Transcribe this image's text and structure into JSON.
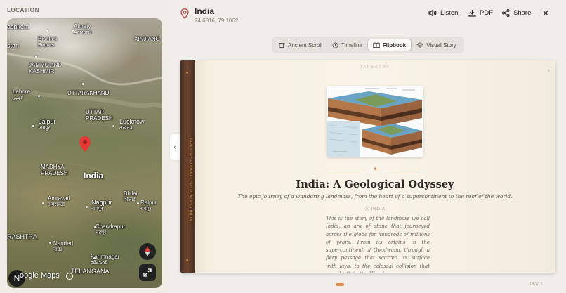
{
  "sidebar": {
    "location_label": "LOCATION",
    "map": {
      "labels": {
        "tashkent_l1": "ashkent",
        "almaty": "Almaty",
        "almaty_local": "Алматы",
        "bishkek": "Bishkek",
        "bishkek_local": "Бишкек",
        "xinjiang": "XINJIANG",
        "stan": "stan",
        "jammu": "JAMMU AND",
        "kashmir": "KASHMIR",
        "lahore": "Lahore",
        "lahore_local": "لاہور",
        "uttarakhand": "UTTARAKHAND",
        "uttar": "UTTAR",
        "pradesh": "PRADESH",
        "jaipur": "Jaipur",
        "jaipur_local": "जयपुर",
        "lucknow": "Lucknow",
        "lucknow_local": "लखनऊ",
        "madhya": "MADHYA",
        "madhya_pradesh": "PRADESH",
        "india": "India",
        "bhilai": "Bhilai",
        "bhilai_local": "भिलाई",
        "raipur": "Raipur",
        "raipur_local": "रायपुर",
        "amravati": "Amravati",
        "amravati_local": "अमरावती",
        "nagpur": "Nagpur",
        "nagpur_local": "नागपूर",
        "maharashtra": "RASHTRA",
        "chandrapur": "Chandrapur",
        "chandrapur_local": "चंद्रपूर",
        "nanded": "Nanded",
        "nanded_local": "नांदेड",
        "karimnagar": "Karimnagar",
        "karimnagar_local": "కరీంనగర్",
        "telangana": "TELANGANA",
        "google_maps": "oogle Maps"
      },
      "n_badge": "N",
      "compass_icon": "compass-icon",
      "expand_icon": "expand-icon"
    },
    "collapse_glyph": "‹"
  },
  "header": {
    "title": "India",
    "coords": "24.6816, 79.1062",
    "listen_label": "Listen",
    "pdf_label": "PDF",
    "share_label": "Share",
    "close_glyph": "✕"
  },
  "tabs": [
    {
      "label": "Ancient Scroll",
      "icon": "scroll-icon",
      "active": false
    },
    {
      "label": "Timeline",
      "icon": "clock-icon",
      "active": false
    },
    {
      "label": "Flipbook",
      "icon": "book-icon",
      "active": true
    },
    {
      "label": "Visual Story",
      "icon": "layers-icon",
      "active": false
    }
  ],
  "book": {
    "spine_text": "TAPESTRY • CONNECTED PLACES • INDIA",
    "tapestry_label": "TAPESTRY",
    "page_mark": "♦",
    "title": "India: A Geological Odyssey",
    "subtitle": "The epic journey of a wandering landmass, from the heart of a supercontinent to the roof of the world.",
    "tag": "INDIA",
    "body": "This is the story of the landmass we call India, an ark of stone that journeyed across the globe for hundreds of millions of years. From its origins in the supercontinent of Gondwana, through a fiery passage that scarred its surface with lava, to the colossal collision that gave birth to the Himalayas,",
    "divider_glyph": "✦"
  },
  "footer": {
    "next_label": "next ›"
  },
  "colors": {
    "accent": "#dd8a4f",
    "spine": "#5a3a28",
    "pin": "#e53935"
  }
}
